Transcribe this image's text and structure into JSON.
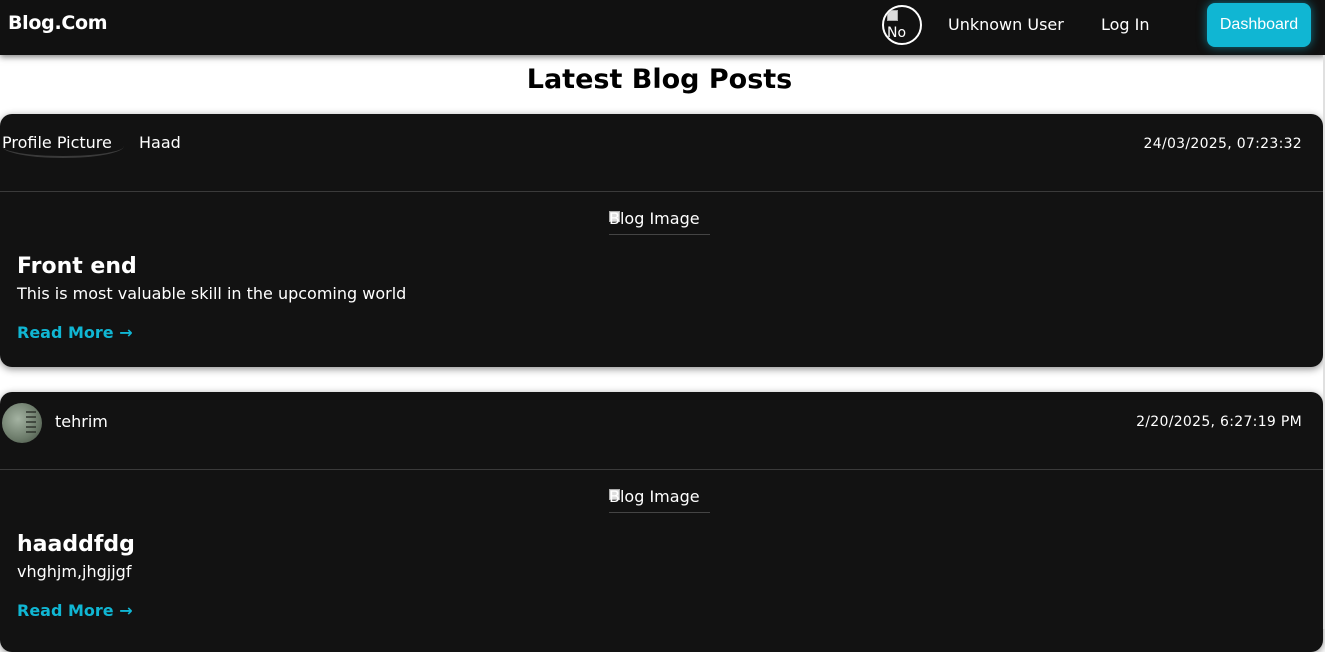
{
  "navbar": {
    "brand": "Blog.Com",
    "avatar_alt": "No",
    "user_label": "Unknown User",
    "login_label": "Log In",
    "dashboard_label": "Dashboard",
    "accent_color": "#10b6d3"
  },
  "page": {
    "title": "Latest Blog Posts"
  },
  "posts": [
    {
      "profile_alt": "Profile Picture",
      "author": "Haad",
      "timestamp": "24/03/2025, 07:23:32",
      "image_alt": "Blog Image",
      "title": "Front end",
      "body": "This is most valuable skill in the upcoming world",
      "read_more": "Read More →"
    },
    {
      "author": "tehrim",
      "timestamp": "2/20/2025, 6:27:19 PM",
      "image_alt": "Blog Image",
      "title": "haaddfdg",
      "body": "vhghjm,jhgjjgf",
      "read_more": "Read More →"
    }
  ]
}
